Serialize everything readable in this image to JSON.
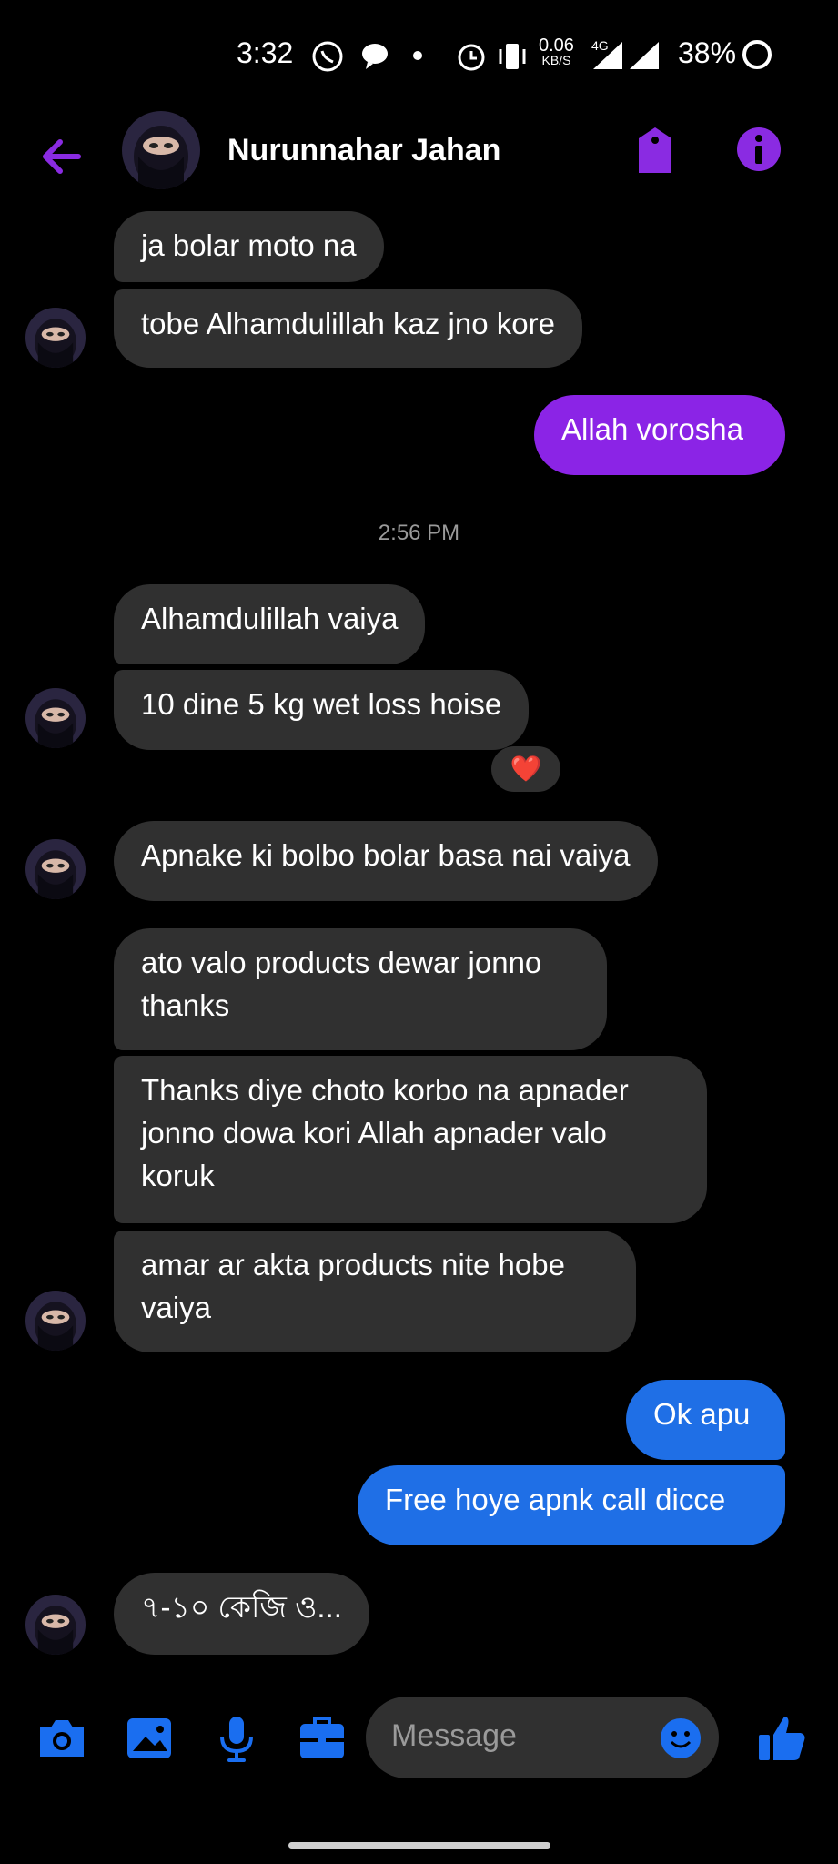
{
  "status_bar": {
    "time": "3:32",
    "net_speed_top": "0.06",
    "net_speed_unit": "KB/S",
    "network": "4G",
    "battery": "38%"
  },
  "header": {
    "contact_name": "Nurunnahar Jahan"
  },
  "messages": [
    {
      "dir": "in",
      "text": "ja bolar moto na"
    },
    {
      "dir": "in",
      "text": "tobe Alhamdulillah kaz jno kore"
    },
    {
      "dir": "out",
      "text": "Allah vorosha"
    },
    {
      "dir": "in",
      "text": "Alhamdulillah vaiya"
    },
    {
      "dir": "in",
      "text": "10 dine 5 kg wet loss hoise"
    },
    {
      "dir": "in",
      "text": "Apnake ki bolbo bolar basa nai vaiya"
    },
    {
      "dir": "in",
      "text": "ato valo products dewar jonno\nthanks"
    },
    {
      "dir": "in",
      "text": "Thanks diye choto korbo na apnader\njonno dowa kori Allah apnader valo\nkoruk"
    },
    {
      "dir": "in",
      "text": "amar ar akta products nite hobe\nvaiya"
    },
    {
      "dir": "out",
      "text": "Ok apu"
    },
    {
      "dir": "out",
      "text": "Free hoye apnk call dicce"
    },
    {
      "dir": "in",
      "text": "৭-১০ কেজি ও..."
    }
  ],
  "timestamp": "2:56 PM",
  "reaction": "❤️",
  "composer": {
    "placeholder": "Message"
  },
  "colors": {
    "accent_purple": "#8a2be2",
    "outgoing_purple": "#8b24e6",
    "outgoing_blue": "#1f6fe6",
    "incoming_bubble": "#303030",
    "composer_icon_blue": "#1a6ef0"
  },
  "icons": [
    "whatsapp-icon",
    "chat-icon",
    "alarm-icon",
    "vibrate-icon",
    "signal-icon",
    "battery-icon",
    "back-arrow-icon",
    "tag-icon",
    "info-icon",
    "camera-icon",
    "image-icon",
    "mic-icon",
    "briefcase-icon",
    "smiley-icon",
    "thumbs-up-icon"
  ]
}
